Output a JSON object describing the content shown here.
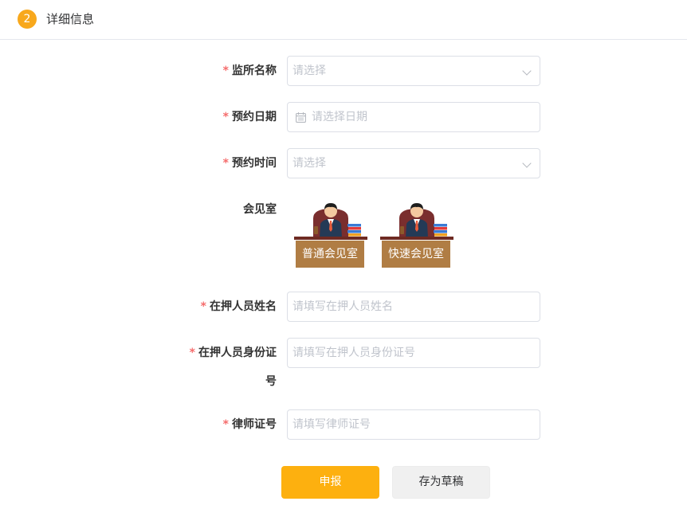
{
  "header": {
    "step_number": "2",
    "title": "详细信息"
  },
  "form": {
    "required_mark": "*",
    "prison_name": {
      "label": "监所名称",
      "placeholder": "请选择"
    },
    "appointment_date": {
      "label": "预约日期",
      "placeholder": "请选择日期"
    },
    "appointment_time": {
      "label": "预约时间",
      "placeholder": "请选择"
    },
    "meeting_room": {
      "label": "会见室",
      "options": [
        "普通会见室",
        "快速会见室"
      ]
    },
    "detainee_name": {
      "label": "在押人员姓名",
      "placeholder": "请填写在押人员姓名"
    },
    "detainee_id": {
      "label_line1": "在押人员身份证",
      "label_line2": "号",
      "placeholder": "请填写在押人员身份证号"
    },
    "lawyer_license": {
      "label": "律师证号",
      "placeholder": "请填写律师证号"
    }
  },
  "actions": {
    "submit_label": "申报",
    "draft_label": "存为草稿"
  },
  "colors": {
    "accent": "#fdb00f",
    "required": "#f56c6c",
    "room_label_bg": "#b07d44"
  },
  "icons": [
    "calendar-icon",
    "chevron-down-icon"
  ]
}
